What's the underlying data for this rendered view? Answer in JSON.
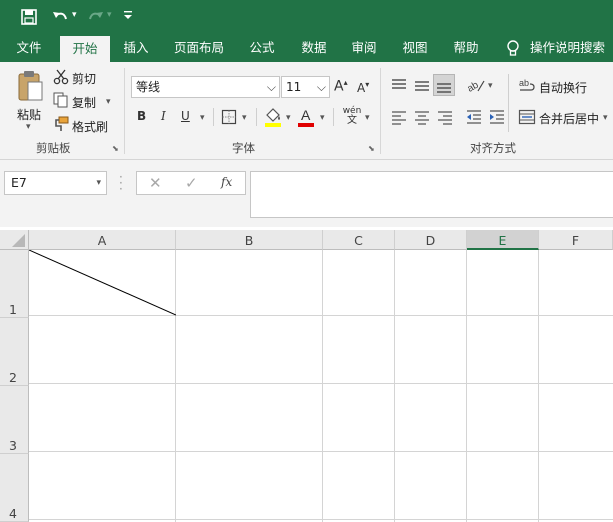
{
  "quick_access": {
    "icons": [
      "save-icon",
      "undo-icon",
      "redo-icon",
      "customize-qat-icon"
    ]
  },
  "tabs": [
    {
      "label": "文件",
      "active": false
    },
    {
      "label": "开始",
      "active": true
    },
    {
      "label": "插入",
      "active": false
    },
    {
      "label": "页面布局",
      "active": false
    },
    {
      "label": "公式",
      "active": false
    },
    {
      "label": "数据",
      "active": false
    },
    {
      "label": "审阅",
      "active": false
    },
    {
      "label": "视图",
      "active": false
    },
    {
      "label": "帮助",
      "active": false
    }
  ],
  "tell_me": {
    "label": "操作说明搜索",
    "icon": "lightbulb-icon"
  },
  "ribbon": {
    "clipboard": {
      "group_label": "剪贴板",
      "paste_label": "粘贴",
      "cut_label": "剪切",
      "copy_label": "复制",
      "format_painter_label": "格式刷"
    },
    "font": {
      "group_label": "字体",
      "font_name": "等线",
      "font_size": "11",
      "bold": "B",
      "italic": "I",
      "underline": "U",
      "phonetic": "wén"
    },
    "alignment": {
      "group_label": "对齐方式",
      "wrap_text_label": "自动换行",
      "merge_center_label": "合并后居中"
    }
  },
  "formula_bar": {
    "name_box": "E7",
    "fx_label": "fx",
    "formula": ""
  },
  "sheet": {
    "columns": [
      "A",
      "B",
      "C",
      "D",
      "E",
      "F"
    ],
    "selected_column": "E",
    "rows": [
      "1",
      "2",
      "3",
      "4"
    ],
    "diagonal_cell": "A1"
  },
  "colors": {
    "accent": "#217346",
    "fill_color": "#ffff00",
    "font_color": "#e00000"
  }
}
